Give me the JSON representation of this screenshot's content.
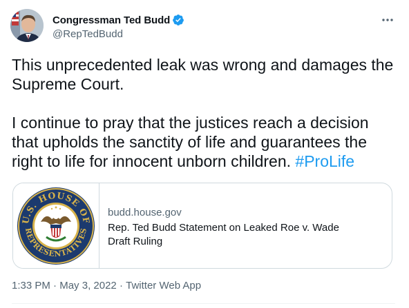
{
  "author": {
    "display_name": "Congressman Ted Budd",
    "handle": "@RepTedBudd",
    "verified": true
  },
  "tweet": {
    "paragraph1": "This unprecedented leak was wrong and damages the Supreme Court.",
    "paragraph2": "I continue to pray that the justices reach a decision that upholds the sanctity of life and guarantees the right to life for innocent unborn children.",
    "hashtag": "#ProLife"
  },
  "card": {
    "domain": "budd.house.gov",
    "title": "Rep. Ted Budd Statement on Leaked Roe v. Wade Draft Ruling",
    "seal_top_text": "U.S. HOUSE OF",
    "seal_bottom_text": "REPRESENTATIVES"
  },
  "meta": {
    "time": "1:33 PM",
    "separator": " · ",
    "date": "May 3, 2022",
    "source": "Twitter Web App"
  },
  "colors": {
    "accent": "#1d9bf0",
    "secondary_text": "#536471",
    "border": "#cfd9de",
    "seal_navy": "#1c3a6e",
    "seal_gold": "#d7b24a"
  },
  "icons": {
    "verified": "verified-badge-icon",
    "more": "more-options-icon"
  }
}
